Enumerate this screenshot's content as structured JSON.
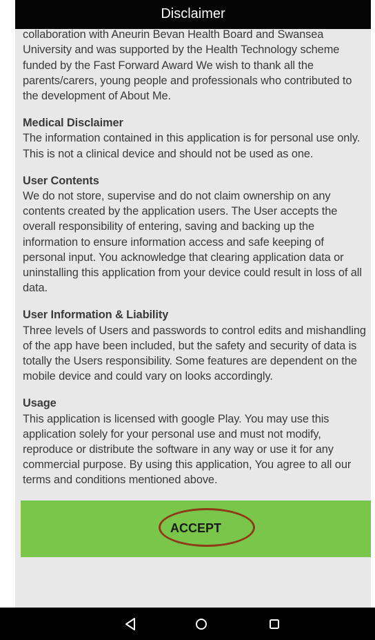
{
  "header": {
    "title": "Disclaimer"
  },
  "content": {
    "intro": "property right belonging to Symconnect Ltd. The development was in collaboration with Aneurin Bevan Health Board and Swansea University and was supported by the Health Technology scheme funded by the Fast Forward Award We wish to thank all the parents/carers, young people and professionals who contributed to the development of About Me.",
    "sections": [
      {
        "heading": "Medical Disclaimer",
        "body": "The information contained in this application is for personal use only. This is not a clinical device and should not be used as one."
      },
      {
        "heading": "User Contents",
        "body": "We do not store, supervise and do not claim ownership on any contents created by the application users. The User accepts the overall responsibility of entering, saving and backing up the information to ensure information access and safe keeping of personal input. You acknowledge that clearing application data or uninstalling this application from your device could result in loss of all data."
      },
      {
        "heading": "User Information & Liability",
        "body": "Three levels of Users and passwords to control edits and mishandling of the app have been included, but the safety and security of data is totally the Users responsibility. Some features are dependent on the mobile device and could vary on looks accordingly."
      },
      {
        "heading": "Usage",
        "body": "This application is licensed with google Play. You may use this application solely for your personal use and must not modify, reproduce or distribute the software in any way or use it for any commercial purpose. By using this application, You agree to all our terms and conditions mentioned above."
      }
    ]
  },
  "footer": {
    "accept_label": "ACCEPT"
  },
  "navigation": {
    "back_icon": "back-triangle-icon",
    "home_icon": "home-circle-icon",
    "recents_icon": "recents-square-icon"
  },
  "colors": {
    "title_bar": "#050505",
    "background": "#e8e8e8",
    "accept_button": "#7ac64b",
    "highlight_ring": "#8e3a16",
    "nav_bar": "#000000"
  }
}
